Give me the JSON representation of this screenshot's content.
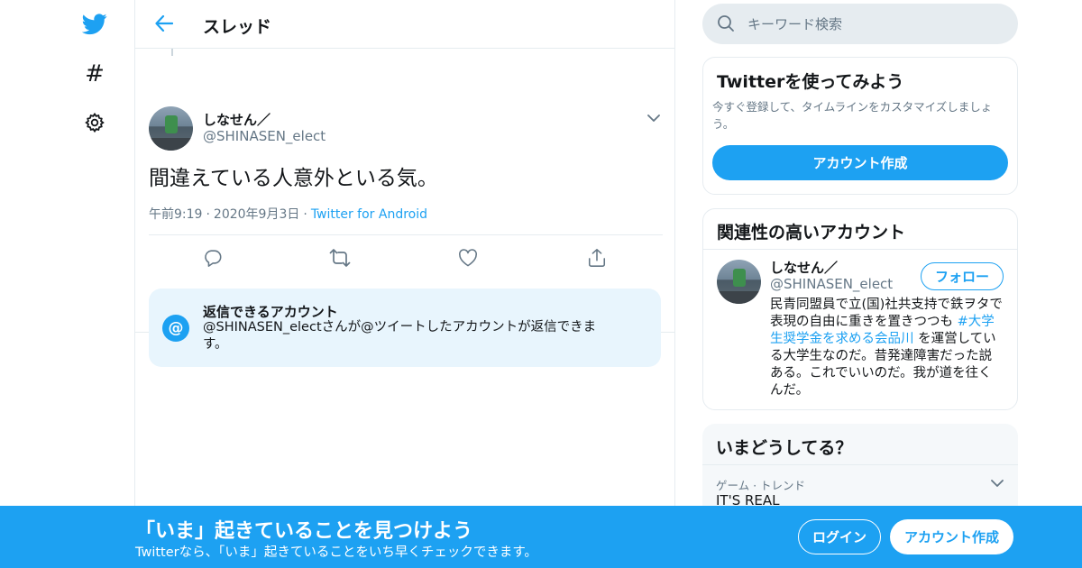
{
  "colors": {
    "accent": "#1da1f2",
    "text": "#14171a",
    "muted": "#657786",
    "border": "#e6ecf0",
    "reply_box_bg": "#e8f5fd"
  },
  "nav": {
    "icons": [
      "twitter-bird-icon",
      "hashtag-icon",
      "gear-icon"
    ],
    "hashtag_glyph": "#"
  },
  "header": {
    "title": "スレッド"
  },
  "tweet": {
    "display_name": "しなせん／",
    "handle": "@SHINASEN_elect",
    "text": "間違えている人意外といる気。",
    "time": "午前9:19",
    "date": "2020年9月3日",
    "client": "Twitter for Android",
    "separator": "·"
  },
  "reply_restriction": {
    "at_glyph": "@",
    "title": "返信できるアカウント",
    "description": "@SHINASEN_electさんが@ツイートしたアカウントが返信できます。"
  },
  "search": {
    "placeholder": "キーワード検索"
  },
  "join_card": {
    "title": "Twitterを使ってみよう",
    "description": "今すぐ登録して、タイムラインをカスタマイズしましょう。",
    "signup_label": "アカウント作成"
  },
  "related_card": {
    "title": "関連性の高いアカウント",
    "name": "しなせん／",
    "handle": "@SHINASEN_elect",
    "follow_label": "フォロー",
    "bio_before": "民青同盟員で立(国)社共支持で鉄ヲタで表現の自由に重きを置きつつも ",
    "bio_tag": "#大学生奨学金を求める会品川",
    "bio_after": " を運営している大学生なのだ。昔発達障害だった説ある。これでいいのだ。我が道を往くんだ。"
  },
  "trends_card": {
    "title": "いまどうしてる？",
    "trend_context": "ゲーム · トレンド",
    "trend_name": "IT'S REAL"
  },
  "banner": {
    "title": "「いま」起きていることを見つけよう",
    "subtitle": "Twitterなら、「いま」起きていることをいち早くチェックできます。",
    "login_label": "ログイン",
    "signup_label": "アカウント作成"
  }
}
